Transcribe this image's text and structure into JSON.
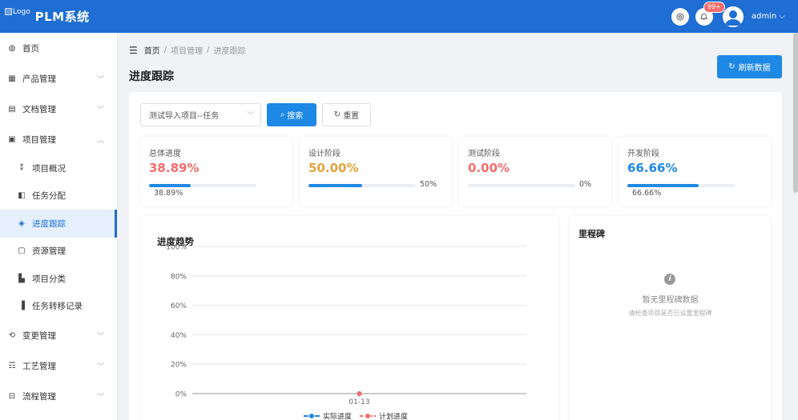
{
  "header": {
    "logo_alt": "Logo",
    "title": "PLM系统",
    "badge": "99+",
    "user": "admin"
  },
  "sidebar": {
    "items": [
      {
        "label": "首页",
        "icon": "dashboard-icon"
      },
      {
        "label": "产品管理",
        "icon": "product-icon",
        "expandable": true
      },
      {
        "label": "文档管理",
        "icon": "document-icon",
        "expandable": true
      },
      {
        "label": "项目管理",
        "icon": "project-icon",
        "expandable": true,
        "expanded": true,
        "children": [
          {
            "label": "项目概况",
            "icon": "overview-icon"
          },
          {
            "label": "任务分配",
            "icon": "task-icon"
          },
          {
            "label": "进度跟踪",
            "icon": "progress-icon",
            "active": true
          },
          {
            "label": "资源管理",
            "icon": "resource-icon"
          },
          {
            "label": "项目分类",
            "icon": "category-icon"
          },
          {
            "label": "任务转移记录",
            "icon": "chart-bar-icon"
          }
        ]
      },
      {
        "label": "变更管理",
        "icon": "change-icon",
        "expandable": true
      },
      {
        "label": "工艺管理",
        "icon": "process-icon",
        "expandable": true
      },
      {
        "label": "流程管理",
        "icon": "workflow-icon",
        "expandable": true
      }
    ]
  },
  "breadcrumb": [
    "首页",
    "项目管理",
    "进度跟踪"
  ],
  "page": {
    "title": "进度跟踪",
    "refresh_label": "刷新数据"
  },
  "filter": {
    "project_value": "测试导入项目--任务",
    "search_label": "搜索",
    "reset_label": "重置"
  },
  "stats": [
    {
      "label": "总体进度",
      "value": "38.89%",
      "percent": 38.89,
      "bar_text": "38.89%",
      "text_pos": "below",
      "color": "#f56c6c"
    },
    {
      "label": "设计阶段",
      "value": "50.00%",
      "percent": 50,
      "bar_text": "50%",
      "text_pos": "right",
      "color": "#e6a23c"
    },
    {
      "label": "测试阶段",
      "value": "0.00%",
      "percent": 0,
      "bar_text": "0%",
      "text_pos": "right",
      "color": "#f56c6c"
    },
    {
      "label": "开发阶段",
      "value": "66.66%",
      "percent": 66.66,
      "bar_text": "66.66%",
      "text_pos": "below",
      "color": "#1e88e5"
    }
  ],
  "chart_data": {
    "type": "line",
    "title": "进度趋势",
    "x": [
      "01-13"
    ],
    "ylim": [
      0,
      100
    ],
    "yticks": [
      "0%",
      "20%",
      "40%",
      "60%",
      "80%",
      "100%"
    ],
    "series": [
      {
        "name": "实际进度",
        "values": [
          0
        ],
        "color": "#1e88e5"
      },
      {
        "name": "计划进度",
        "values": [
          0
        ],
        "color": "#f56c6c"
      }
    ],
    "legend": "bottom",
    "grid": true
  },
  "milestone": {
    "title": "里程碑",
    "empty": "暂无里程碑数据",
    "hint": "请检查项目是否已设置里程碑"
  }
}
